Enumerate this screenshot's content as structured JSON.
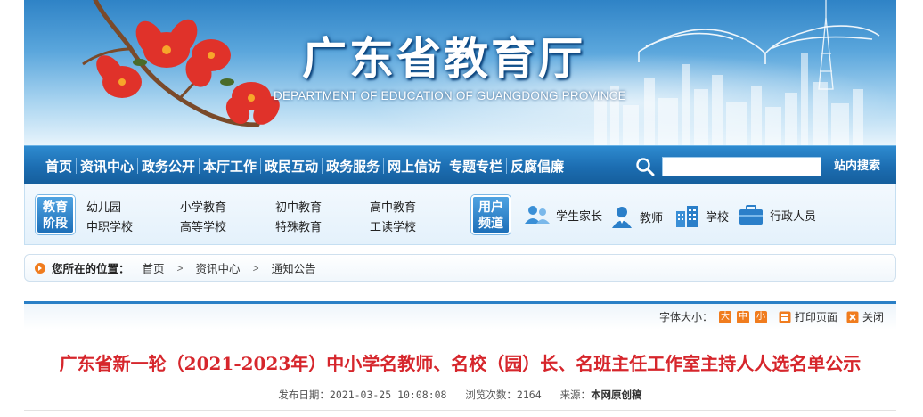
{
  "header": {
    "title": "广东省教育厅",
    "subtitle": "DEPARTMENT OF EDUCATION OF GUANGDONG PROVINCE"
  },
  "nav": {
    "items": [
      "首页",
      "资讯中心",
      "政务公开",
      "本厅工作",
      "政民互动",
      "政务服务",
      "网上信访",
      "专题专栏",
      "反腐倡廉"
    ],
    "search_value": "",
    "search_button": "站内搜索"
  },
  "quick": {
    "stage_tag": [
      "教育",
      "阶段"
    ],
    "stages": [
      "幼儿园",
      "小学教育",
      "初中教育",
      "高中教育",
      "中职学校",
      "高等学校",
      "特殊教育",
      "工读学校"
    ],
    "user_tag": [
      "用户",
      "频道"
    ],
    "users": [
      "学生家长",
      "教师",
      "学校",
      "行政人员"
    ]
  },
  "breadcrumb": {
    "label": "您所在的位置：",
    "items": [
      "首页",
      "资讯中心",
      "通知公告"
    ]
  },
  "toolbar": {
    "font_size_label": "字体大小：",
    "sizes": [
      "大",
      "中",
      "小"
    ],
    "print": "打印页面",
    "close": "关闭"
  },
  "article": {
    "title": "广东省新一轮（2021-2023年）中小学名教师、名校（园）长、名班主任工作室主持人人选名单公示",
    "date_label": "发布日期：",
    "date": "2021-03-25 10:08:08",
    "views_label": "浏览次数：",
    "views": "2164",
    "source_label": "来源：",
    "source": "本网原创稿"
  },
  "colors": {
    "nav_blue": "#1c6db1",
    "title_red": "#d6262c",
    "accent_orange": "#f07c1e"
  }
}
